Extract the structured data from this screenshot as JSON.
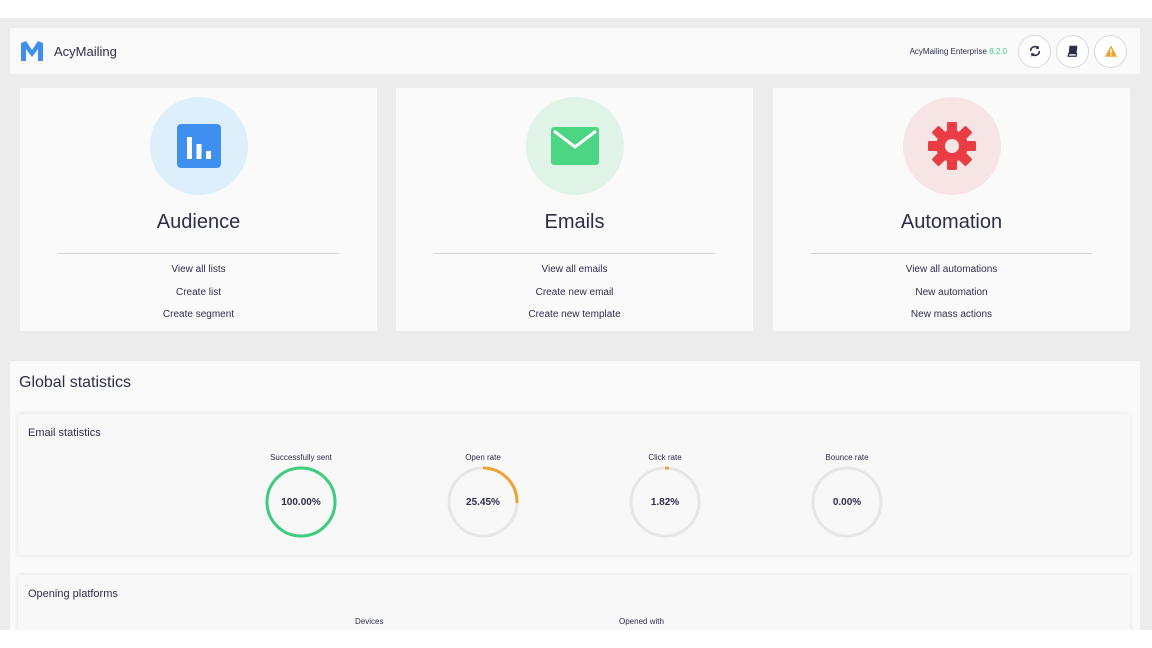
{
  "header": {
    "app_name": "AcyMailing",
    "edition": "AcyMailing Enterprise",
    "version": "8.2.0",
    "buttons": [
      {
        "name": "refresh-icon"
      },
      {
        "name": "documentation-icon"
      },
      {
        "name": "warning-icon"
      }
    ]
  },
  "cards": [
    {
      "title": "Audience",
      "icon": "chart-bars-icon",
      "links": [
        "View all lists",
        "Create list",
        "Create segment"
      ]
    },
    {
      "title": "Emails",
      "icon": "envelope-icon",
      "links": [
        "View all emails",
        "Create new email",
        "Create new template"
      ]
    },
    {
      "title": "Automation",
      "icon": "gear-icon",
      "links": [
        "View all automations",
        "New automation",
        "New mass actions"
      ]
    }
  ],
  "stats": {
    "title": "Global statistics",
    "email_panel": {
      "title": "Email statistics",
      "gauges": [
        {
          "label": "Successfully sent",
          "value": "100.00%",
          "percent": 100,
          "color": "#3ecc7e"
        },
        {
          "label": "Open rate",
          "value": "25.45%",
          "percent": 25.45,
          "color": "#f0a332"
        },
        {
          "label": "Click rate",
          "value": "1.82%",
          "percent": 1.82,
          "color": "#f0a332"
        },
        {
          "label": "Bounce rate",
          "value": "0.00%",
          "percent": 0,
          "color": "#f0a332"
        }
      ]
    },
    "platforms_panel": {
      "title": "Opening platforms",
      "devices_label": "Devices",
      "opened_with_label": "Opened with"
    }
  },
  "colors": {
    "audience_bg": "#dceffb",
    "audience_icon": "#3f8ff1",
    "emails_bg": "#dff4e7",
    "emails_icon": "#4cd683",
    "automation_bg": "#f7e4e5",
    "automation_icon": "#ea3c45",
    "track": "#e6e6e6"
  }
}
